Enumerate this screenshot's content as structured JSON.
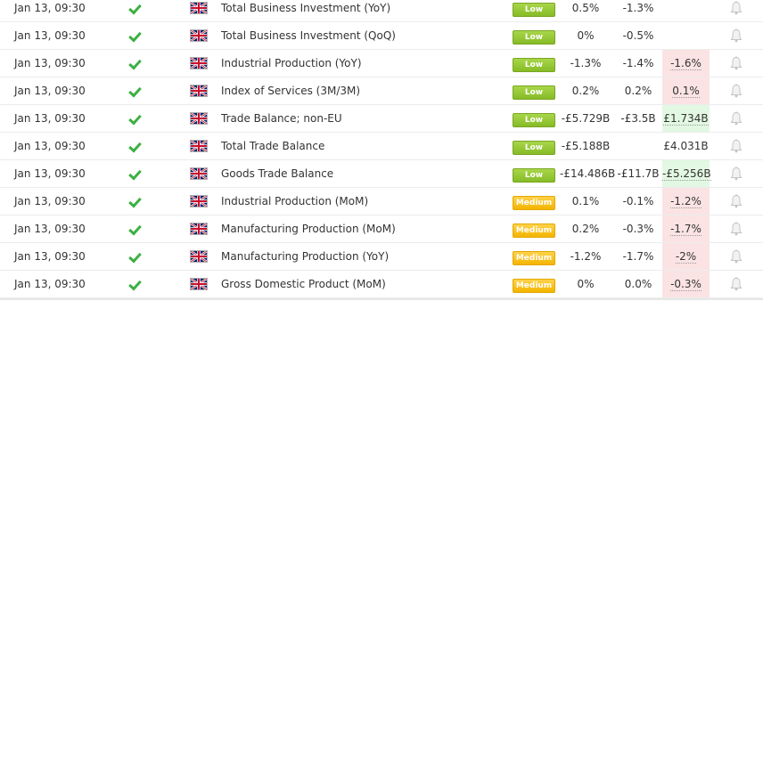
{
  "rows": [
    {
      "time": "Jan 13, 09:30",
      "event": "Total Business Investment (YoY)",
      "impact": "Low",
      "impact_level": "low",
      "previous": "0.5%",
      "consensus": "-1.3%",
      "actual": "",
      "actual_tone": "none"
    },
    {
      "time": "Jan 13, 09:30",
      "event": "Total Business Investment (QoQ)",
      "impact": "Low",
      "impact_level": "low",
      "previous": "0%",
      "consensus": "-0.5%",
      "actual": "",
      "actual_tone": "none"
    },
    {
      "time": "Jan 13, 09:30",
      "event": "Industrial Production (YoY)",
      "impact": "Low",
      "impact_level": "low",
      "previous": "-1.3%",
      "consensus": "-1.4%",
      "actual": "-1.6%",
      "actual_tone": "negative"
    },
    {
      "time": "Jan 13, 09:30",
      "event": "Index of Services (3M/3M)",
      "impact": "Low",
      "impact_level": "low",
      "previous": "0.2%",
      "consensus": "0.2%",
      "actual": "0.1%",
      "actual_tone": "negative"
    },
    {
      "time": "Jan 13, 09:30",
      "event": "Trade Balance; non-EU",
      "impact": "Low",
      "impact_level": "low",
      "previous": "-£5.729B",
      "consensus": "-£3.5B",
      "actual": "£1.734B",
      "actual_tone": "positive"
    },
    {
      "time": "Jan 13, 09:30",
      "event": "Total Trade Balance",
      "impact": "Low",
      "impact_level": "low",
      "previous": "-£5.188B",
      "consensus": "",
      "actual": "£4.031B",
      "actual_tone": "none"
    },
    {
      "time": "Jan 13, 09:30",
      "event": "Goods Trade Balance",
      "impact": "Low",
      "impact_level": "low",
      "previous": "-£14.486B",
      "consensus": "-£11.7B",
      "actual": "-£5.256B",
      "actual_tone": "positive"
    },
    {
      "time": "Jan 13, 09:30",
      "event": "Industrial Production (MoM)",
      "impact": "Medium",
      "impact_level": "medium",
      "previous": "0.1%",
      "consensus": "-0.1%",
      "actual": "-1.2%",
      "actual_tone": "negative"
    },
    {
      "time": "Jan 13, 09:30",
      "event": "Manufacturing Production (MoM)",
      "impact": "Medium",
      "impact_level": "medium",
      "previous": "0.2%",
      "consensus": "-0.3%",
      "actual": "-1.7%",
      "actual_tone": "negative"
    },
    {
      "time": "Jan 13, 09:30",
      "event": "Manufacturing Production (YoY)",
      "impact": "Medium",
      "impact_level": "medium",
      "previous": "-1.2%",
      "consensus": "-1.7%",
      "actual": "-2%",
      "actual_tone": "negative"
    },
    {
      "time": "Jan 13, 09:30",
      "event": "Gross Domestic Product (MoM)",
      "impact": "Medium",
      "impact_level": "medium",
      "previous": "0%",
      "consensus": "0.0%",
      "actual": "-0.3%",
      "actual_tone": "negative"
    }
  ],
  "icons": {
    "status": "checkmark-icon",
    "country": "uk-flag-icon",
    "alert": "bell-icon"
  },
  "colors": {
    "check": "#3cb043",
    "low_badge": "#94c732",
    "medium_badge": "#f8c21c",
    "negative_bg": "#fbe3e3",
    "positive_bg": "#e3f8e3"
  }
}
